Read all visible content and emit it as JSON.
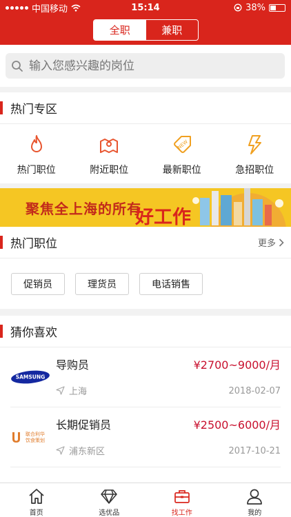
{
  "status": {
    "carrier": "中国移动",
    "time": "15:14",
    "battery": "38%"
  },
  "header": {
    "seg_full": "全职",
    "seg_part": "兼职"
  },
  "search": {
    "placeholder": "输入您感兴趣的岗位"
  },
  "hot_zone": {
    "title": "热门专区",
    "items": [
      {
        "label": "热门职位",
        "icon": "flame-icon"
      },
      {
        "label": "附近职位",
        "icon": "map-pin-icon"
      },
      {
        "label": "最新职位",
        "icon": "new-tag-icon"
      },
      {
        "label": "急招职位",
        "icon": "lightning-icon"
      }
    ]
  },
  "banner": {
    "line1": "聚焦全上海的所有",
    "line2": "好工作"
  },
  "hot_jobs": {
    "title": "热门职位",
    "more": "更多",
    "tags": [
      "促销员",
      "理货员",
      "电话销售"
    ]
  },
  "recommend": {
    "title": "猜你喜欢",
    "jobs": [
      {
        "title": "导购员",
        "salary": "¥2700~9000/月",
        "location": "上海",
        "date": "2018-02-07",
        "logo_text": "SAMSUNG"
      },
      {
        "title": "长期促销员",
        "salary": "¥2500~6000/月",
        "location": "浦东新区",
        "date": "2017-10-21",
        "logo_text": "联合利华饮食策划"
      }
    ]
  },
  "tabbar": [
    {
      "label": "首页",
      "icon": "home-icon"
    },
    {
      "label": "选优品",
      "icon": "diamond-icon"
    },
    {
      "label": "找工作",
      "icon": "briefcase-icon",
      "active": true
    },
    {
      "label": "我的",
      "icon": "user-icon"
    }
  ],
  "colors": {
    "brand": "#d9251c",
    "salary": "#c8102e",
    "banner": "#f5c623"
  }
}
